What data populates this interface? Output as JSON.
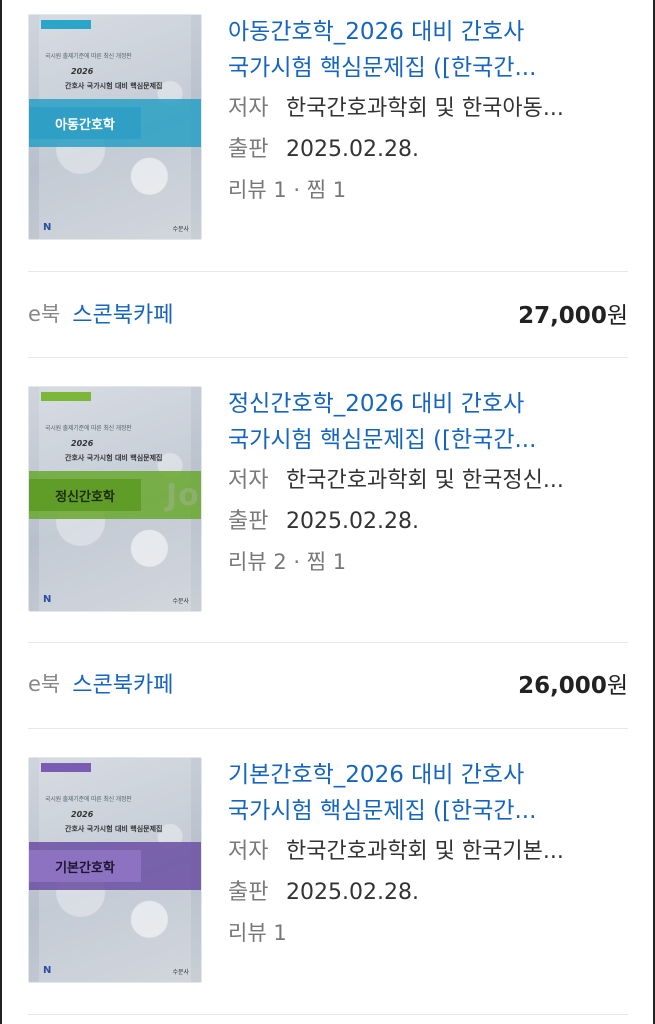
{
  "books": [
    {
      "cover": {
        "color": "#29a0c4",
        "tag_color": "#2aa6c8",
        "subtitle": "국시원 출제기준에 따른 최신 개정판",
        "year": "2026",
        "headline": "간호사 국가시험 대비 핵심문제집",
        "label": "아동간호학",
        "publisher_mark": "N",
        "publisher_small": "수문사"
      },
      "title_line1": "아동간호학_2026 대비 간호사",
      "title_line2": "국가시험 핵심문제집 ([한국간...",
      "author_key": "저자",
      "author": "한국간호과학회 및 한국아동...",
      "pub_key": "출판",
      "pub_date": "2025.02.28.",
      "stats": "리뷰 1 · 찜 1",
      "format": "e북",
      "seller": "스콘북카페",
      "price": "27,000",
      "currency": "원"
    },
    {
      "cover": {
        "color": "#6aa82e",
        "tag_color": "#7bb83a",
        "subtitle": "국시원 출제기준에 따른 최신 개정판",
        "year": "2026",
        "headline": "간호사 국가시험 대비 핵심문제집",
        "label": "정신간호학",
        "publisher_mark": "N",
        "publisher_small": "수문사"
      },
      "title_line1": "정신간호학_2026 대비 간호사",
      "title_line2": "국가시험 핵심문제집 ([한국간...",
      "author_key": "저자",
      "author": "한국간호과학회 및 한국정신...",
      "pub_key": "출판",
      "pub_date": "2025.02.28.",
      "stats": "리뷰 2 · 찜 1",
      "format": "e북",
      "seller": "스콘북카페",
      "price": "26,000",
      "currency": "원"
    },
    {
      "cover": {
        "color": "#6b4fa3",
        "tag_color": "#7a5cb3",
        "subtitle": "국시원 출제기준에 따른 최신 개정판",
        "year": "2026",
        "headline": "간호사 국가시험 대비 핵심문제집",
        "label": "기본간호학",
        "publisher_mark": "N",
        "publisher_small": "수문사"
      },
      "title_line1": "기본간호학_2026 대비 간호사",
      "title_line2": "국가시험 핵심문제집 ([한국간...",
      "author_key": "저자",
      "author": "한국간호과학회 및 한국기본...",
      "pub_key": "출판",
      "pub_date": "2025.02.28.",
      "stats": "리뷰 1"
    }
  ],
  "watermark": "Jo"
}
